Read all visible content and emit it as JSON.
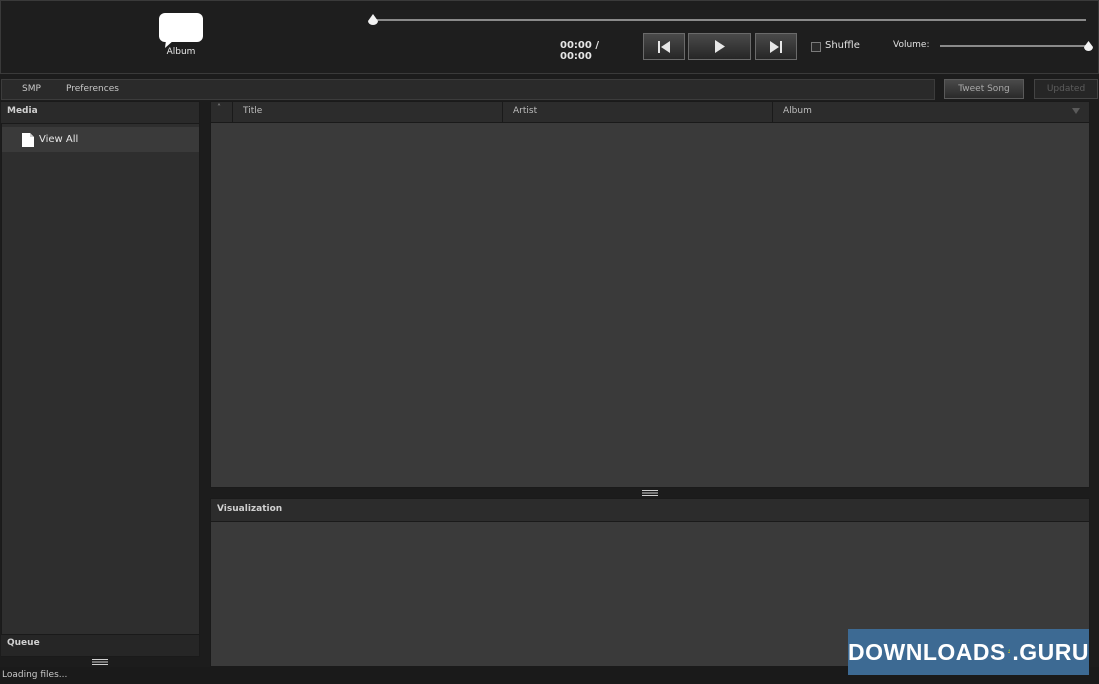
{
  "player": {
    "album_label": "Album",
    "time": "00:00 / 00:00",
    "shuffle_label": "Shuffle",
    "shuffle_checked": false,
    "volume_label": "Volume:",
    "volume_level": 1.0,
    "seek_position": 0.0
  },
  "tabs": [
    {
      "label": "SMP"
    },
    {
      "label": "Preferences"
    }
  ],
  "actions": {
    "tweet_song": "Tweet Song",
    "updated": "Updated"
  },
  "sidebar": {
    "media_title": "Media",
    "items": [
      {
        "label": "View All",
        "icon": "file-icon"
      }
    ],
    "queue_title": "Queue"
  },
  "tracklist": {
    "sort_indicator": "˄",
    "columns": [
      "Title",
      "Artist",
      "Album"
    ],
    "rows": []
  },
  "visualization": {
    "title": "Visualization"
  },
  "status": {
    "text": "Loading files..."
  },
  "watermark": {
    "text_left": "DOWNLOADS",
    "text_right": ".GURU"
  },
  "colors": {
    "background": "#1c1c1c",
    "panel": "#3a3a3a",
    "watermark": "#3d6a93"
  }
}
